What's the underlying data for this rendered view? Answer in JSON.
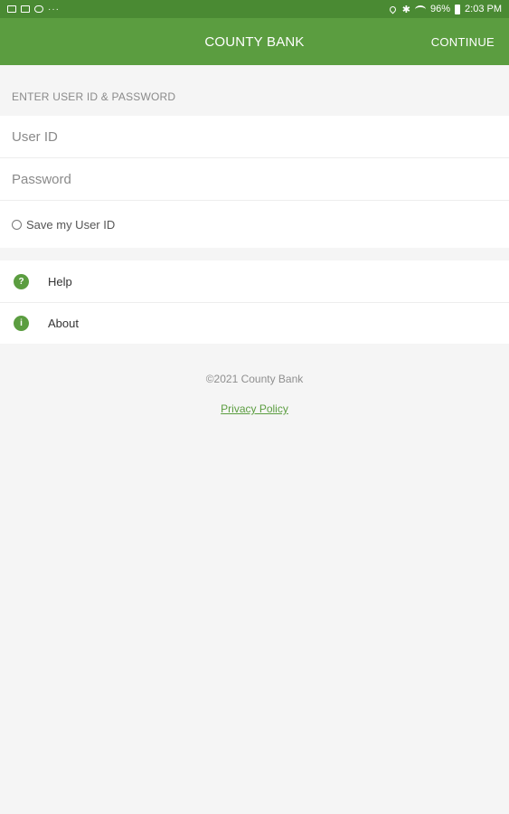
{
  "status_bar": {
    "left_icons": [
      "gallery-icon",
      "image-icon",
      "cloud-icon"
    ],
    "more": "···",
    "battery": "96%",
    "time": "2:03 PM"
  },
  "header": {
    "title": "COUNTY BANK",
    "continue_label": "CONTINUE"
  },
  "login": {
    "section_label": "ENTER USER ID & PASSWORD",
    "user_id_placeholder": "User ID",
    "password_placeholder": "Password",
    "save_label": "Save my User ID"
  },
  "menu": {
    "items": [
      {
        "label": "Help",
        "icon": "?",
        "icon_name": "help-icon"
      },
      {
        "label": "About",
        "icon": "i",
        "icon_name": "info-icon"
      }
    ]
  },
  "footer": {
    "copyright": "©2021 County Bank",
    "privacy_label": "Privacy Policy"
  },
  "colors": {
    "status_bar": "#4a8a33",
    "brand_green": "#5b9d40",
    "background": "#f5f5f5"
  }
}
